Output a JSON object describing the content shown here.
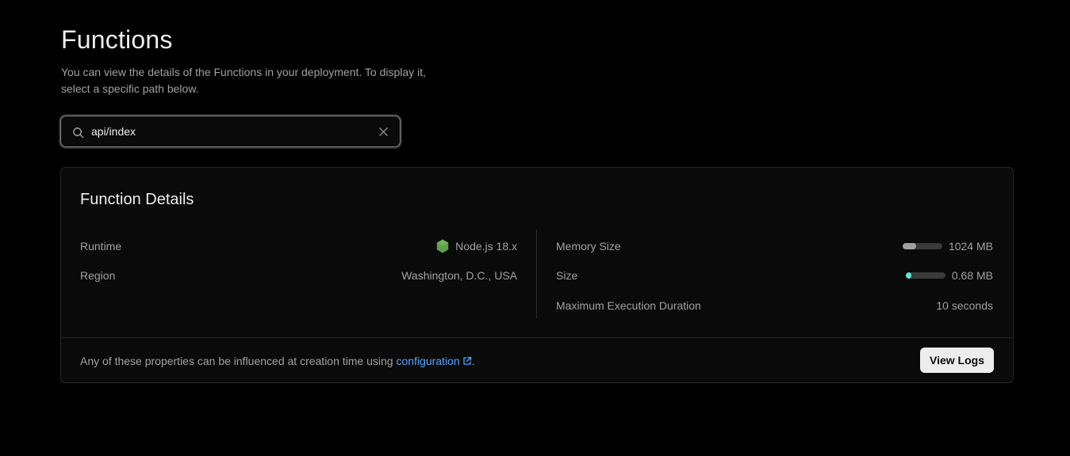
{
  "header": {
    "title": "Functions",
    "description": "You can view the details of the Functions in your deployment. To display it, select a specific path below."
  },
  "search": {
    "value": "api/index",
    "icon": "search-icon",
    "clear_icon": "close-icon"
  },
  "details": {
    "title": "Function Details",
    "left": [
      {
        "label": "Runtime",
        "value": "Node.js 18.x",
        "icon": "nodejs-icon"
      },
      {
        "label": "Region",
        "value": "Washington, D.C., USA"
      }
    ],
    "right": [
      {
        "label": "Memory Size",
        "value": "1024 MB",
        "meter_fraction": 0.35,
        "meter_color": "#a1a1a1"
      },
      {
        "label": "Size",
        "value": "0.68 MB",
        "meter_fraction": 0.15,
        "meter_color": "#62e4d6"
      },
      {
        "label": "Maximum Execution Duration",
        "value": "10 seconds"
      }
    ]
  },
  "footer": {
    "text_before": "Any of these properties can be influenced at creation time using ",
    "link_label": "configuration",
    "text_after": ".",
    "button_label": "View Logs"
  },
  "colors": {
    "background": "#000000",
    "card": "#0a0a0a",
    "link": "#52a8ff",
    "nodejs": "#5fa04e"
  }
}
